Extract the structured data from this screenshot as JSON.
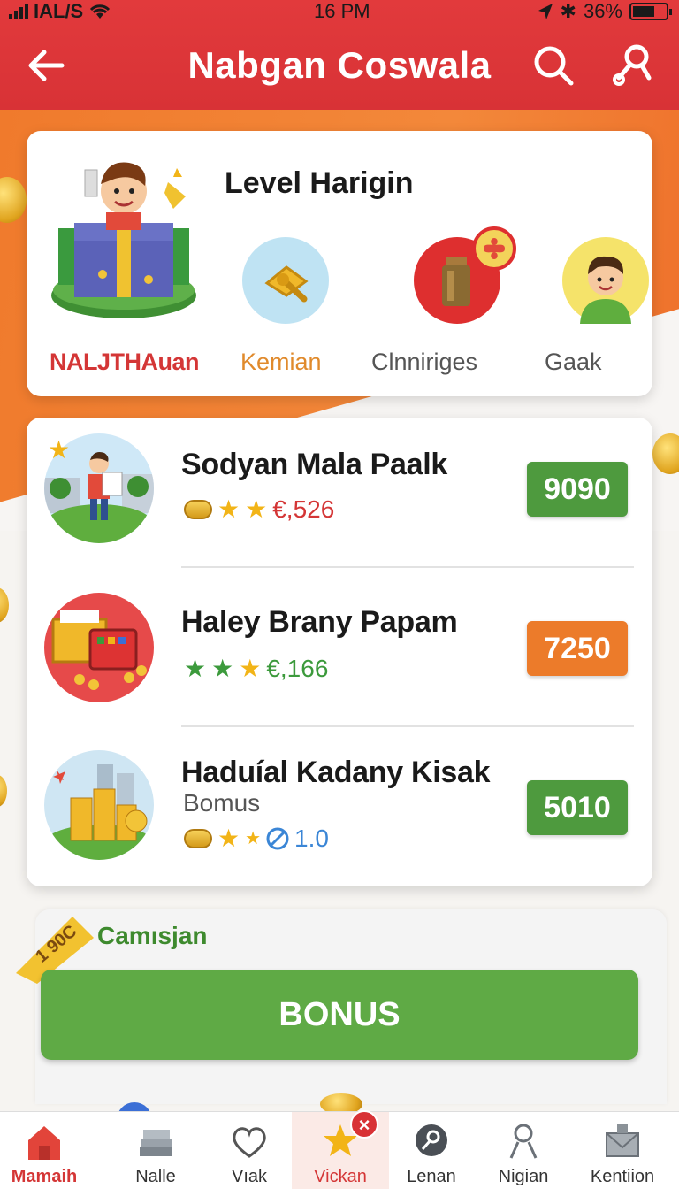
{
  "status_bar": {
    "carrier": "IAL/S",
    "time": "16 PM",
    "battery": "36%"
  },
  "header": {
    "title": "Nabgan Coswala",
    "back_icon": "arrow-left-icon",
    "search_icon": "search-icon",
    "profile_icon": "user-key-icon",
    "color": "#d83236"
  },
  "level_card": {
    "title": "Level Harigin",
    "categories": [
      {
        "label": "NALJTHAuan",
        "icon": "gift-character-icon"
      },
      {
        "label": "Kemian",
        "icon": "gold-tool-icon"
      },
      {
        "label": "Clnniriges",
        "icon": "bottle-badge-icon"
      },
      {
        "label": "Gaak",
        "icon": "avatar-icon"
      }
    ]
  },
  "offers": [
    {
      "name": "Sodyan Mala Paalk",
      "sub": "",
      "meta": "€,526",
      "score": "9090",
      "score_color": "#4e9a3e"
    },
    {
      "name": "Haley Brany Papam",
      "sub": "",
      "meta": "€,166",
      "score": "7250",
      "score_color": "#ec7b2a"
    },
    {
      "name": "Haduíal Kadany Kisak",
      "sub": "Bomus",
      "meta": "1.0",
      "score": "5010",
      "score_color": "#4e9a3e"
    }
  ],
  "campaign": {
    "label": "Camısjan",
    "ribbon_text": "1 90C",
    "button_label": "BONUS"
  },
  "tabs": [
    {
      "label": "Mamaih",
      "icon": "home-icon"
    },
    {
      "label": "Nalle",
      "icon": "stack-icon"
    },
    {
      "label": "Vıak",
      "icon": "heart-icon"
    },
    {
      "label": "Vickan",
      "icon": "star-icon",
      "badge": "×"
    },
    {
      "label": "Lenan",
      "icon": "search-circle-icon"
    },
    {
      "label": "Nigian",
      "icon": "user-icon"
    },
    {
      "label": "Kentiion",
      "icon": "mail-icon"
    }
  ]
}
